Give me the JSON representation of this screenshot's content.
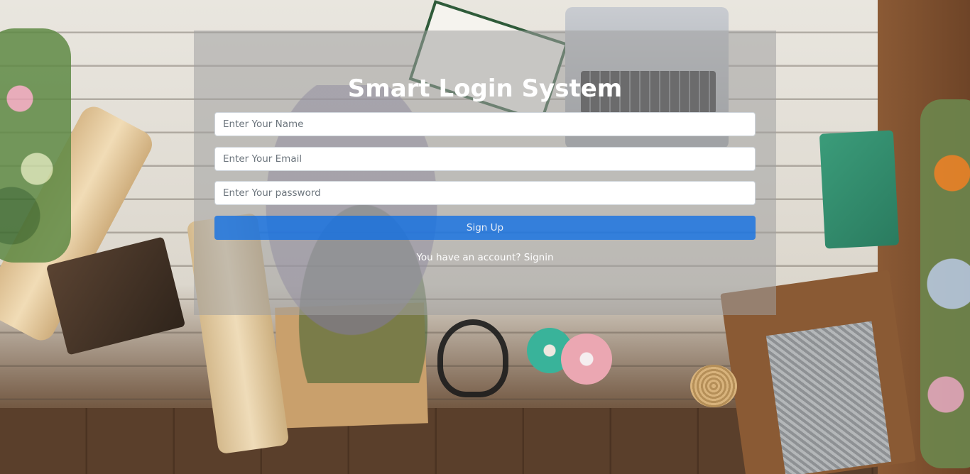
{
  "page": {
    "title": "Smart Login System"
  },
  "form": {
    "name_placeholder": "Enter Your Name",
    "email_placeholder": "Enter Your Email",
    "password_placeholder": "Enter Your password",
    "submit_label": "Sign Up"
  },
  "footer": {
    "prompt": "You have an account?",
    "link_label": "Signin"
  },
  "colors": {
    "panel": "#a0a0a0",
    "button": "#0d6efd",
    "title_text": "#ffffff"
  }
}
